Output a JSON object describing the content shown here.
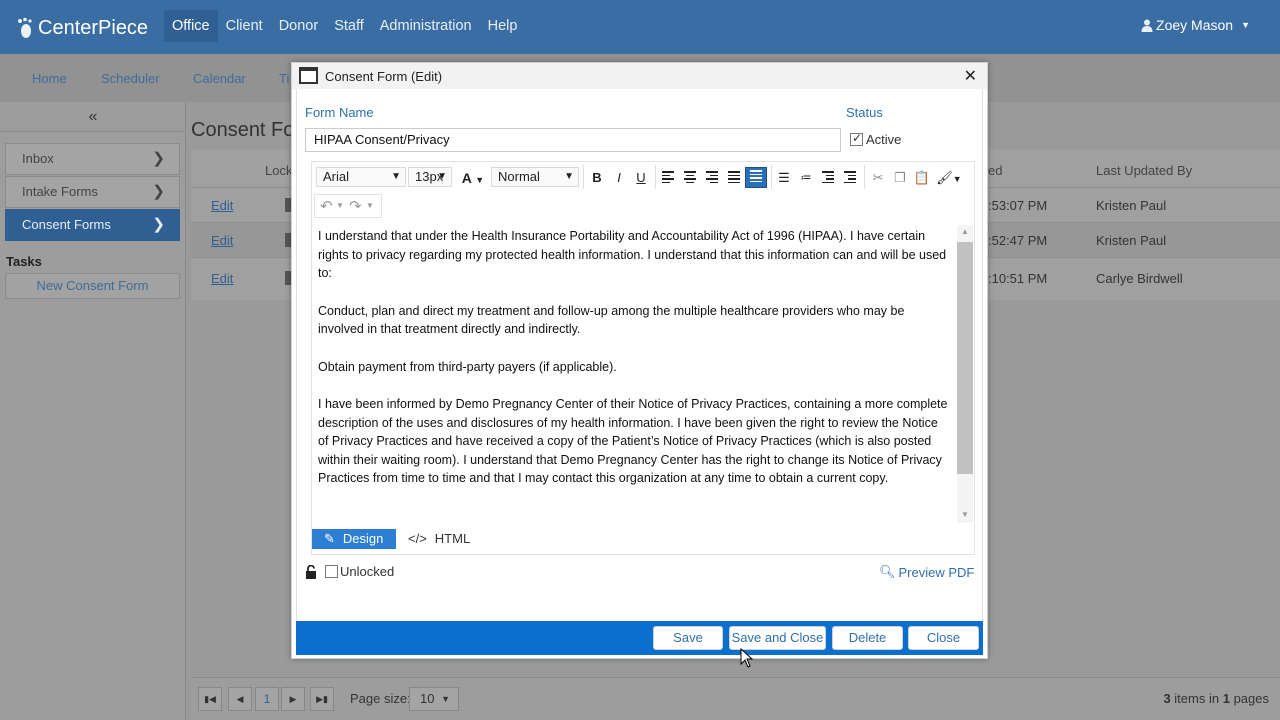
{
  "app": {
    "brand": "CenterPiece",
    "top_nav": [
      "Office",
      "Client",
      "Donor",
      "Staff",
      "Administration",
      "Help"
    ],
    "user": "Zoey Mason"
  },
  "sub_nav": [
    "Home",
    "Scheduler",
    "Calendar",
    "Ti"
  ],
  "sidebar": {
    "collapse": "«",
    "items": [
      {
        "label": "Inbox"
      },
      {
        "label": "Intake Forms"
      },
      {
        "label": "Consent Forms"
      }
    ],
    "tasks_title": "Tasks",
    "new_button": "New Consent Form"
  },
  "page": {
    "title": "Consent Fo",
    "grid": {
      "headers": {
        "locked": "Lock",
        "updated": "ed",
        "updated_by": "Last Updated By"
      },
      "rows": [
        {
          "edit": "Edit",
          "time": ":53:07 PM",
          "by": "Kristen Paul"
        },
        {
          "edit": "Edit",
          "time": ":52:47 PM",
          "by": "Kristen Paul"
        },
        {
          "edit": "Edit",
          "time": ":10:51 PM",
          "by": "Carlye Birdwell"
        }
      ]
    },
    "pager": {
      "current": "1",
      "page_size_label": "Page size:",
      "page_size": "10",
      "count_bold": "3",
      "count_text": "items in",
      "pages_bold": "1",
      "pages_text": "pages"
    }
  },
  "modal": {
    "title": "Consent Form (Edit)",
    "close": "✕",
    "form_name_label": "Form Name",
    "form_name_value": "HIPAA Consent/Privacy",
    "status_label": "Status",
    "status_active": "Active",
    "toolbar": {
      "font": "Arial",
      "size": "13px",
      "format": "Normal"
    },
    "content": [
      "I understand that under the Health Insurance Portability and Accountability Act of 1996 (HIPAA). I have certain rights to privacy regarding my protected health information. I understand that this information can and will be used to:",
      "Conduct, plan and direct my treatment and follow-up among the multiple healthcare providers who may be involved in that treatment directly and indirectly.",
      "Obtain payment from third-party payers (if applicable).",
      "I have been informed by Demo Pregnancy Center of their Notice of Privacy Practices, containing a more complete description of the uses and disclosures of my health information. I have been given the right to review the Notice of Privacy Practices and have received a copy of the Patient’s Notice of Privacy Practices (which is also posted within their waiting room). I understand that Demo Pregnancy Center has the right to change its Notice of Privacy Practices from time to time and that I may contact this organization at any time to obtain a current copy."
    ],
    "mode_design": "Design",
    "mode_html": "HTML",
    "unlocked_label": "Unlocked",
    "preview_pdf": "Preview PDF",
    "buttons": {
      "save": "Save",
      "save_close": "Save and Close",
      "delete": "Delete",
      "close": "Close"
    }
  },
  "colors": {
    "nav": "#3a6da4",
    "accent": "#0a6fcf",
    "link": "#2f6fad"
  }
}
